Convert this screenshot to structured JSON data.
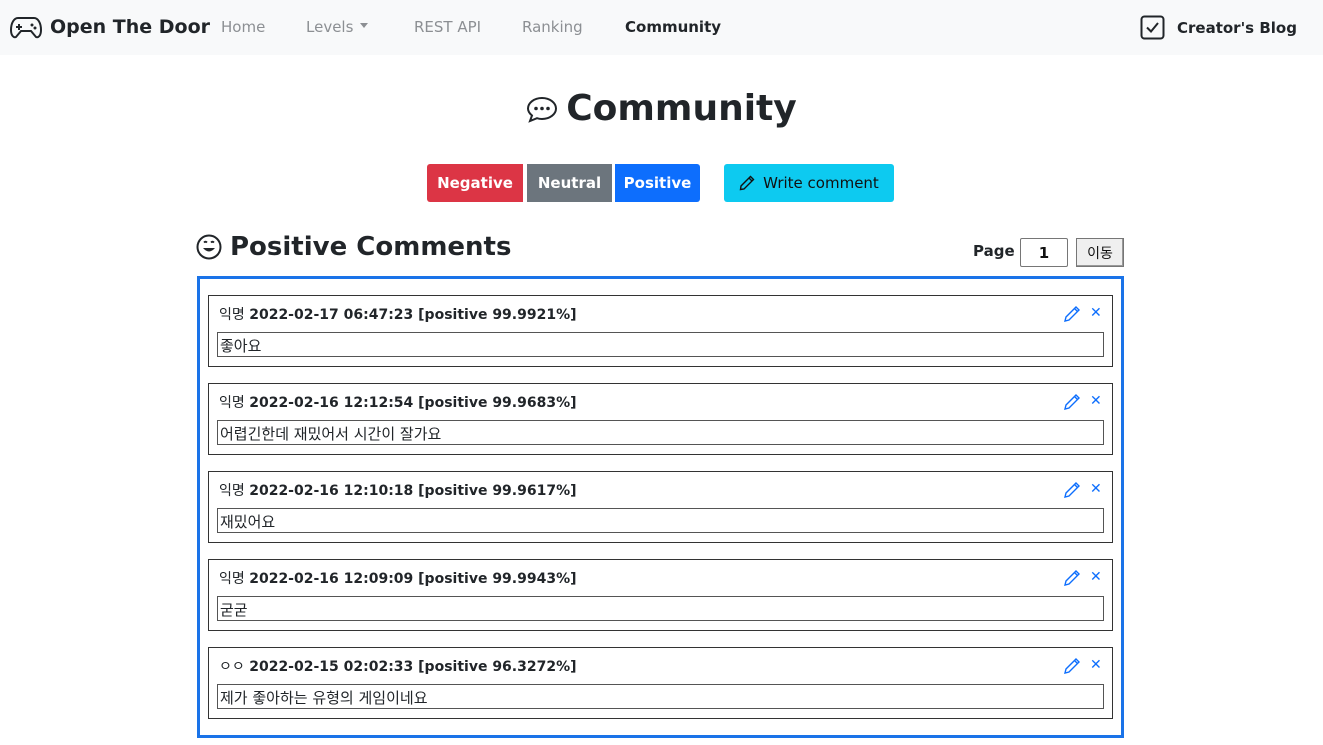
{
  "nav": {
    "brand": "Open The Door",
    "items": [
      {
        "label": "Home",
        "active": false
      },
      {
        "label": "Levels",
        "active": false,
        "dropdown": true
      },
      {
        "label": "REST API",
        "active": false
      },
      {
        "label": "Ranking",
        "active": false
      },
      {
        "label": "Community",
        "active": true
      }
    ],
    "blog": "Creator's Blog"
  },
  "page": {
    "title": "Community"
  },
  "filters": {
    "negative": "Negative",
    "neutral": "Neutral",
    "positive": "Positive",
    "write": "Write comment"
  },
  "section": {
    "title": "Positive Comments"
  },
  "pager": {
    "label": "Page",
    "value": "1",
    "go": "이동"
  },
  "comments": [
    {
      "author": "익명",
      "stamp": "2022-02-17 06:47:23 [positive 99.9921%]",
      "text": "좋아요"
    },
    {
      "author": "익명",
      "stamp": "2022-02-16 12:12:54 [positive 99.9683%]",
      "text": "어렵긴한데 재밌어서 시간이 잘가요"
    },
    {
      "author": "익명",
      "stamp": "2022-02-16 12:10:18 [positive 99.9617%]",
      "text": "재밌어요"
    },
    {
      "author": "익명",
      "stamp": "2022-02-16 12:09:09 [positive 99.9943%]",
      "text": "굳굳"
    },
    {
      "author": "ㅇㅇ",
      "stamp": "2022-02-15 02:02:33 [positive 96.3272%]",
      "text": "제가 좋아하는 유형의 게임이네요"
    }
  ],
  "colors": {
    "negative": "#dc3545",
    "neutral": "#6c757d",
    "positive": "#0d6efd",
    "write": "#0dcaf0",
    "frame": "#1a73e8"
  },
  "icons": {
    "brand": "gamepad-icon",
    "blog": "check-square-icon",
    "title": "chat-dots-icon",
    "section": "smile-icon",
    "write": "pencil-icon",
    "edit": "pencil-icon",
    "delete": "close-icon"
  }
}
